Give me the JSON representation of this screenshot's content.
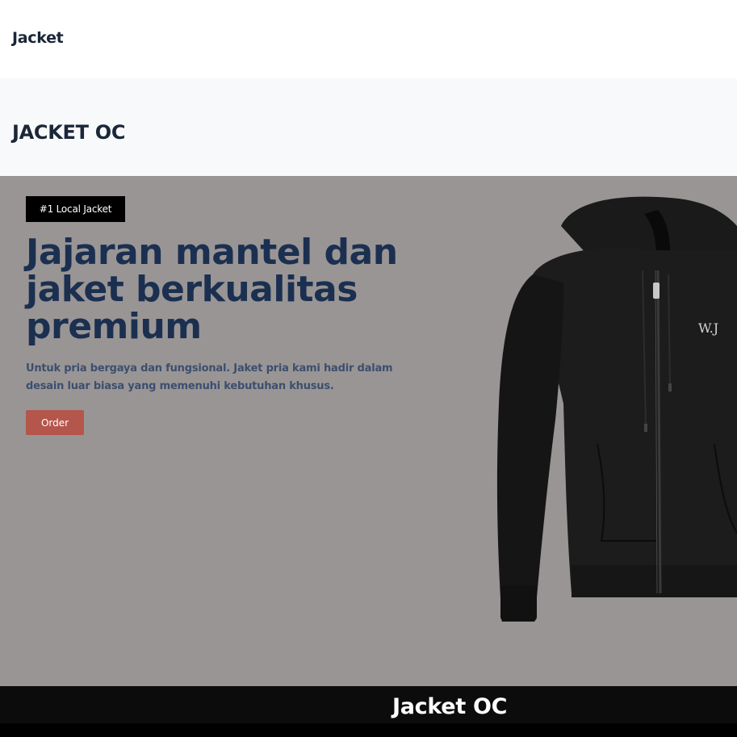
{
  "nav": {
    "brand": "Jacket"
  },
  "section": {
    "title": "JACKET OC"
  },
  "hero": {
    "badge": "#1 Local Jacket",
    "headline": "Jajaran mantel dan jaket berkualitas premium",
    "subtext": "Untuk pria bergaya dan fungsional. Jaket pria kami hadir dalam desain luar biasa yang memenuhi kebutuhan khusus.",
    "order_label": "Order",
    "image": {
      "name": "hoodie-product-image",
      "embroidery": "W.J"
    }
  },
  "footer": {
    "title": "Jacket OC"
  },
  "colors": {
    "navy": "#1b3050",
    "hero_bg": "#9a9595",
    "button": "#b4564b",
    "footer_bg": "#0c0c0c"
  }
}
